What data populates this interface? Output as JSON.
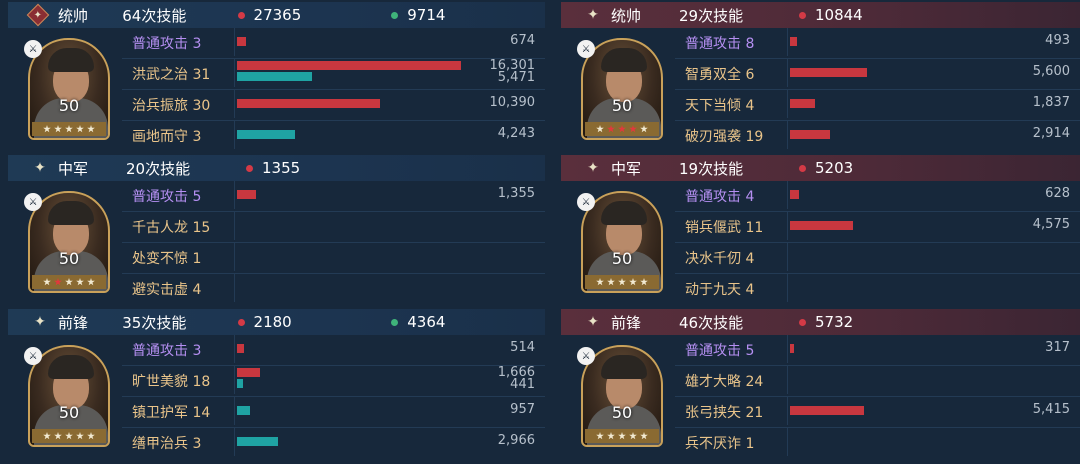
{
  "max_value": 16301,
  "left": [
    {
      "role": "统帅",
      "role_style": "badge",
      "skills": "64次技能",
      "damage": "27365",
      "heal": "9714",
      "level": "50",
      "stars": [
        "w",
        "w",
        "w",
        "w",
        "w"
      ],
      "rows": [
        {
          "name": "普通攻击",
          "count": "3",
          "basic": true,
          "dmg": 674,
          "dmg_label": "674"
        },
        {
          "name": "洪武之治",
          "count": "31",
          "dmg": 16301,
          "dmg_label": "16,301",
          "heal": 5471,
          "heal_label": "5,471"
        },
        {
          "name": "治兵振旅",
          "count": "30",
          "dmg": 10390,
          "dmg_label": "10,390"
        },
        {
          "name": "画地而守",
          "count": "3",
          "heal": 4243,
          "heal_label": "4,243"
        }
      ]
    },
    {
      "role": "中军",
      "role_style": "sparkle",
      "skills": "20次技能",
      "damage": "1355",
      "heal": "",
      "level": "50",
      "stars": [
        "w",
        "r",
        "w",
        "w",
        "w"
      ],
      "rows": [
        {
          "name": "普通攻击",
          "count": "5",
          "basic": true,
          "dmg": 1355,
          "dmg_label": "1,355"
        },
        {
          "name": "千古人龙",
          "count": "15"
        },
        {
          "name": "处变不惊",
          "count": "1"
        },
        {
          "name": "避实击虚",
          "count": "4"
        }
      ]
    },
    {
      "role": "前锋",
      "role_style": "sparkle",
      "skills": "35次技能",
      "damage": "2180",
      "heal": "4364",
      "level": "50",
      "stars": [
        "w",
        "w",
        "w",
        "w",
        "w"
      ],
      "rows": [
        {
          "name": "普通攻击",
          "count": "3",
          "basic": true,
          "dmg": 514,
          "dmg_label": "514"
        },
        {
          "name": "旷世美貌",
          "count": "18",
          "dmg": 1666,
          "dmg_label": "1,666",
          "heal": 441,
          "heal_label": "441"
        },
        {
          "name": "镇卫护军",
          "count": "14",
          "heal": 957,
          "heal_label": "957"
        },
        {
          "name": "缮甲治兵",
          "count": "3",
          "heal": 2966,
          "heal_label": "2,966"
        }
      ]
    }
  ],
  "right": [
    {
      "role": "统帅",
      "role_style": "sparkle",
      "skills": "29次技能",
      "damage": "10844",
      "heal": "",
      "level": "50",
      "stars": [
        "w",
        "r",
        "r",
        "r",
        "w"
      ],
      "rows": [
        {
          "name": "普通攻击",
          "count": "8",
          "basic": true,
          "dmg": 493,
          "dmg_label": "493"
        },
        {
          "name": "智勇双全",
          "count": "6",
          "dmg": 5600,
          "dmg_label": "5,600"
        },
        {
          "name": "天下当倾",
          "count": "4",
          "dmg": 1837,
          "dmg_label": "1,837"
        },
        {
          "name": "破刃强袭",
          "count": "19",
          "dmg": 2914,
          "dmg_label": "2,914"
        }
      ]
    },
    {
      "role": "中军",
      "role_style": "sparkle",
      "skills": "19次技能",
      "damage": "5203",
      "heal": "",
      "level": "50",
      "stars": [
        "w",
        "w",
        "w",
        "w",
        "w"
      ],
      "rows": [
        {
          "name": "普通攻击",
          "count": "4",
          "basic": true,
          "dmg": 628,
          "dmg_label": "628"
        },
        {
          "name": "销兵偃武",
          "count": "11",
          "dmg": 4575,
          "dmg_label": "4,575"
        },
        {
          "name": "决水千仞",
          "count": "4"
        },
        {
          "name": "动于九天",
          "count": "4"
        }
      ]
    },
    {
      "role": "前锋",
      "role_style": "sparkle",
      "skills": "46次技能",
      "damage": "5732",
      "heal": "",
      "level": "50",
      "stars": [
        "w",
        "w",
        "w",
        "w",
        "w"
      ],
      "rows": [
        {
          "name": "普通攻击",
          "count": "5",
          "basic": true,
          "dmg": 317,
          "dmg_label": "317"
        },
        {
          "name": "雄才大略",
          "count": "24"
        },
        {
          "name": "张弓挟矢",
          "count": "21",
          "dmg": 5415,
          "dmg_label": "5,415"
        },
        {
          "name": "兵不厌诈",
          "count": "1"
        }
      ]
    }
  ]
}
